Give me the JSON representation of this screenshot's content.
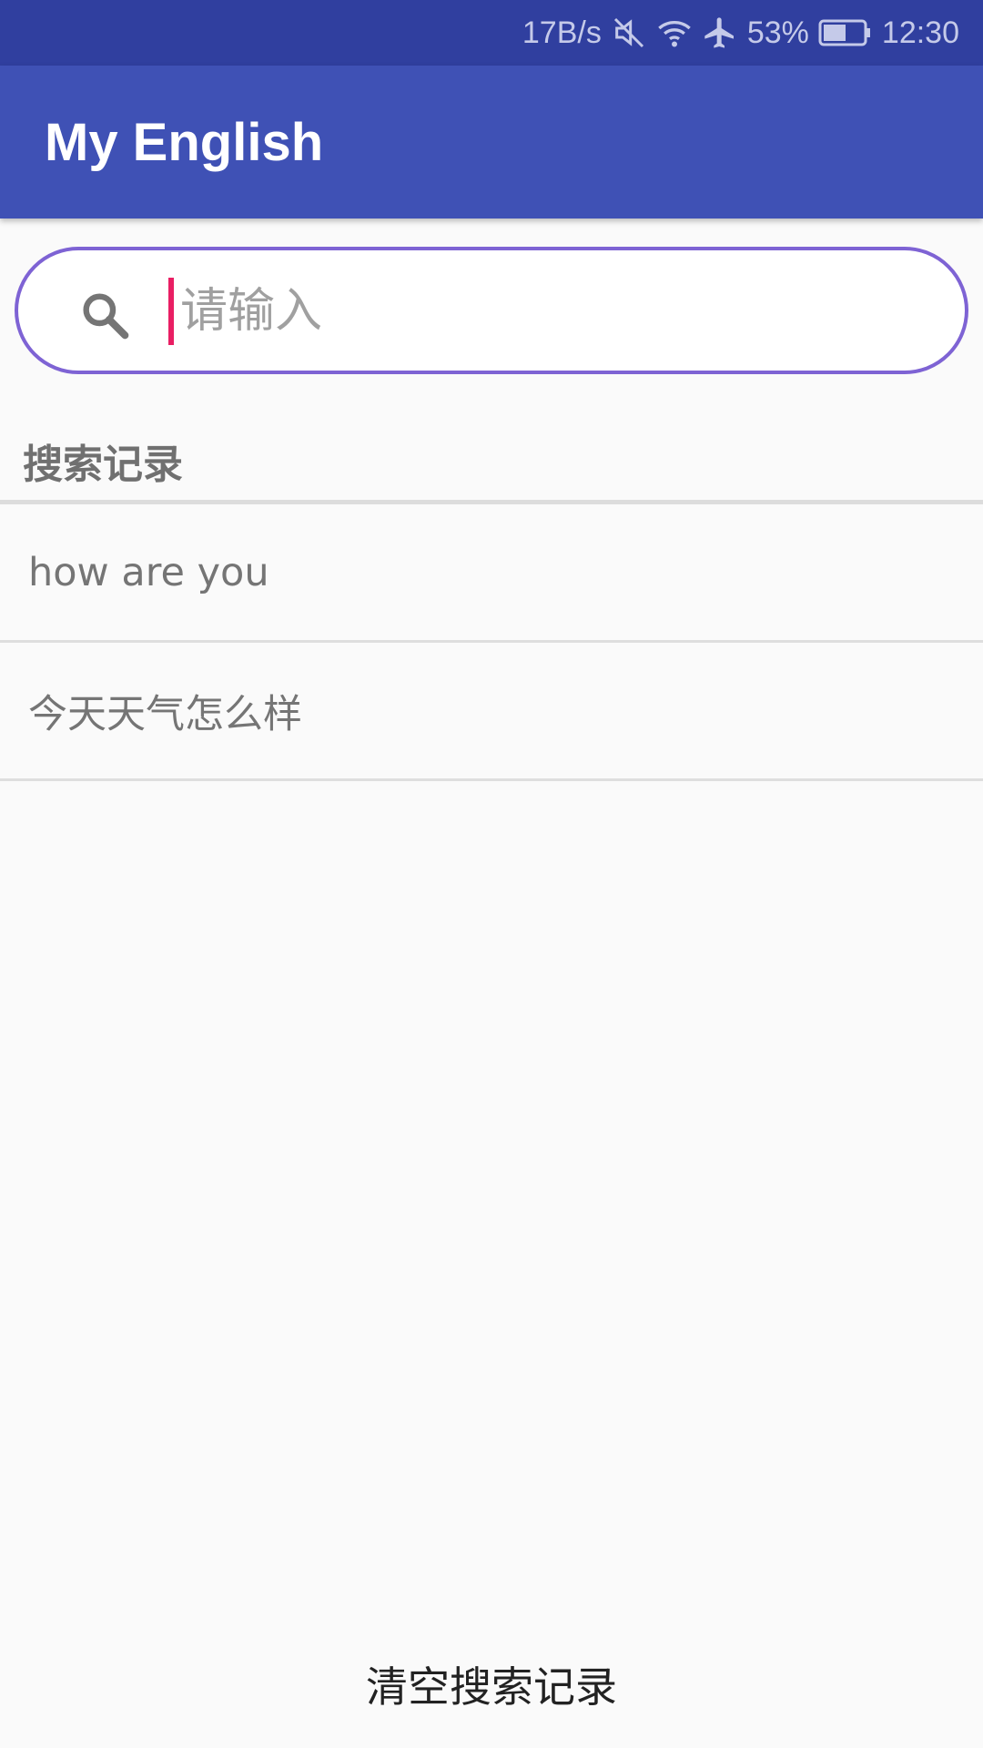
{
  "status_bar": {
    "net_speed": "17B/s",
    "battery": "53%",
    "time": "12:30",
    "icons": [
      "mute-icon",
      "wifi-icon",
      "airplane-icon",
      "battery-icon"
    ],
    "text_color": "#c5cae9"
  },
  "app_bar": {
    "title": "My English",
    "color": "#3f51b5"
  },
  "search": {
    "placeholder": "请输入",
    "value": "",
    "icon": "search-icon",
    "border_color": "#7e63d4"
  },
  "history": {
    "title": "搜索记录",
    "items": [
      {
        "text": "how are you"
      },
      {
        "text": "今天天气怎么样"
      }
    ]
  },
  "footer": {
    "clear_label": "清空搜索记录"
  }
}
